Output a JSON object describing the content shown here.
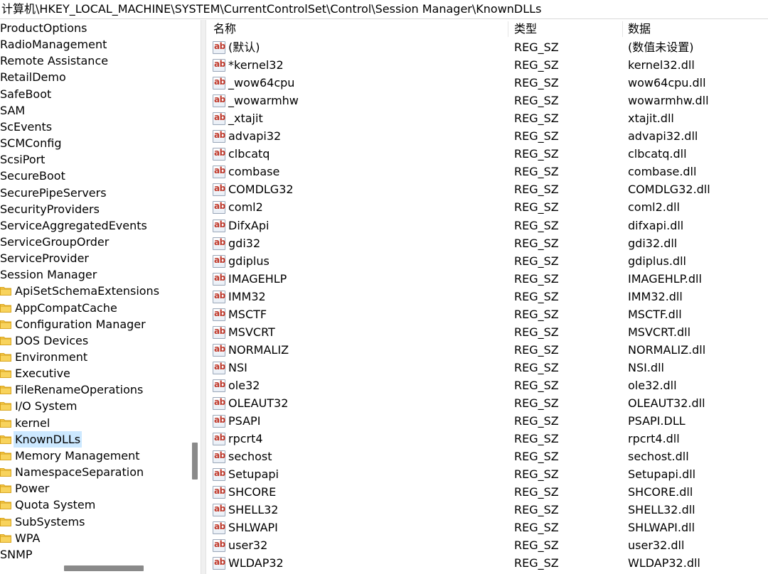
{
  "address": {
    "path": "计算机\\HKEY_LOCAL_MACHINE\\SYSTEM\\CurrentControlSet\\Control\\Session Manager\\KnownDLLs"
  },
  "tree": {
    "items": [
      {
        "label": "ProductOptions",
        "level": 0
      },
      {
        "label": "RadioManagement",
        "level": 0
      },
      {
        "label": "Remote Assistance",
        "level": 0
      },
      {
        "label": "RetailDemo",
        "level": 0
      },
      {
        "label": "SafeBoot",
        "level": 0
      },
      {
        "label": "SAM",
        "level": 0
      },
      {
        "label": "ScEvents",
        "level": 0
      },
      {
        "label": "SCMConfig",
        "level": 0
      },
      {
        "label": "ScsiPort",
        "level": 0
      },
      {
        "label": "SecureBoot",
        "level": 0
      },
      {
        "label": "SecurePipeServers",
        "level": 0
      },
      {
        "label": "SecurityProviders",
        "level": 0
      },
      {
        "label": "ServiceAggregatedEvents",
        "level": 0
      },
      {
        "label": "ServiceGroupOrder",
        "level": 0
      },
      {
        "label": "ServiceProvider",
        "level": 0
      },
      {
        "label": "Session Manager",
        "level": 0
      },
      {
        "label": "ApiSetSchemaExtensions",
        "level": 1
      },
      {
        "label": "AppCompatCache",
        "level": 1
      },
      {
        "label": "Configuration Manager",
        "level": 1
      },
      {
        "label": "DOS Devices",
        "level": 1
      },
      {
        "label": "Environment",
        "level": 1
      },
      {
        "label": "Executive",
        "level": 1
      },
      {
        "label": "FileRenameOperations",
        "level": 1
      },
      {
        "label": "I/O System",
        "level": 1
      },
      {
        "label": "kernel",
        "level": 1
      },
      {
        "label": "KnownDLLs",
        "level": 1,
        "selected": true
      },
      {
        "label": "Memory Management",
        "level": 1
      },
      {
        "label": "NamespaceSeparation",
        "level": 1
      },
      {
        "label": "Power",
        "level": 1
      },
      {
        "label": "Quota System",
        "level": 1
      },
      {
        "label": "SubSystems",
        "level": 1
      },
      {
        "label": "WPA",
        "level": 1
      },
      {
        "label": "SNMP",
        "level": 0
      }
    ]
  },
  "columns": {
    "name": "名称",
    "type": "类型",
    "data": "数据"
  },
  "values": [
    {
      "name": "(默认)",
      "type": "REG_SZ",
      "data": "(数值未设置)"
    },
    {
      "name": "*kernel32",
      "type": "REG_SZ",
      "data": "kernel32.dll"
    },
    {
      "name": "_wow64cpu",
      "type": "REG_SZ",
      "data": "wow64cpu.dll"
    },
    {
      "name": "_wowarmhw",
      "type": "REG_SZ",
      "data": "wowarmhw.dll"
    },
    {
      "name": "_xtajit",
      "type": "REG_SZ",
      "data": "xtajit.dll"
    },
    {
      "name": "advapi32",
      "type": "REG_SZ",
      "data": "advapi32.dll"
    },
    {
      "name": "clbcatq",
      "type": "REG_SZ",
      "data": "clbcatq.dll"
    },
    {
      "name": "combase",
      "type": "REG_SZ",
      "data": "combase.dll"
    },
    {
      "name": "COMDLG32",
      "type": "REG_SZ",
      "data": "COMDLG32.dll"
    },
    {
      "name": "coml2",
      "type": "REG_SZ",
      "data": "coml2.dll"
    },
    {
      "name": "DifxApi",
      "type": "REG_SZ",
      "data": "difxapi.dll"
    },
    {
      "name": "gdi32",
      "type": "REG_SZ",
      "data": "gdi32.dll"
    },
    {
      "name": "gdiplus",
      "type": "REG_SZ",
      "data": "gdiplus.dll"
    },
    {
      "name": "IMAGEHLP",
      "type": "REG_SZ",
      "data": "IMAGEHLP.dll"
    },
    {
      "name": "IMM32",
      "type": "REG_SZ",
      "data": "IMM32.dll"
    },
    {
      "name": "MSCTF",
      "type": "REG_SZ",
      "data": "MSCTF.dll"
    },
    {
      "name": "MSVCRT",
      "type": "REG_SZ",
      "data": "MSVCRT.dll"
    },
    {
      "name": "NORMALIZ",
      "type": "REG_SZ",
      "data": "NORMALIZ.dll"
    },
    {
      "name": "NSI",
      "type": "REG_SZ",
      "data": "NSI.dll"
    },
    {
      "name": "ole32",
      "type": "REG_SZ",
      "data": "ole32.dll"
    },
    {
      "name": "OLEAUT32",
      "type": "REG_SZ",
      "data": "OLEAUT32.dll"
    },
    {
      "name": "PSAPI",
      "type": "REG_SZ",
      "data": "PSAPI.DLL"
    },
    {
      "name": "rpcrt4",
      "type": "REG_SZ",
      "data": "rpcrt4.dll"
    },
    {
      "name": "sechost",
      "type": "REG_SZ",
      "data": "sechost.dll"
    },
    {
      "name": "Setupapi",
      "type": "REG_SZ",
      "data": "Setupapi.dll"
    },
    {
      "name": "SHCORE",
      "type": "REG_SZ",
      "data": "SHCORE.dll"
    },
    {
      "name": "SHELL32",
      "type": "REG_SZ",
      "data": "SHELL32.dll"
    },
    {
      "name": "SHLWAPI",
      "type": "REG_SZ",
      "data": "SHLWAPI.dll"
    },
    {
      "name": "user32",
      "type": "REG_SZ",
      "data": "user32.dll"
    },
    {
      "name": "WLDAP32",
      "type": "REG_SZ",
      "data": "WLDAP32.dll"
    }
  ],
  "icons": {
    "folder": "folder-icon",
    "string_value": "string-value-icon",
    "string_value_glyph": "ab"
  },
  "colors": {
    "folder": "#f6c744",
    "selection": "#cce8ff",
    "ab_text": "#c0392b"
  }
}
